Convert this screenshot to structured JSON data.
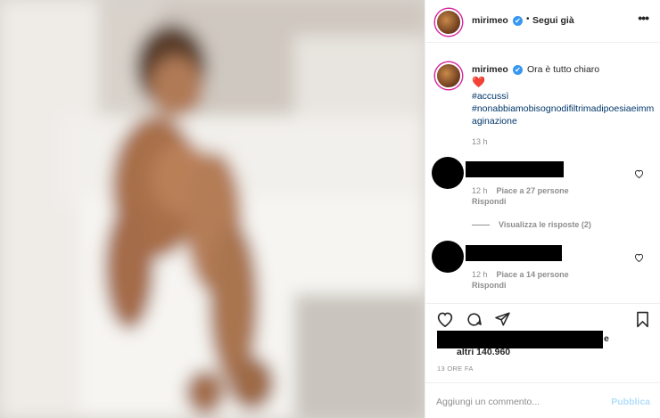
{
  "post": {
    "username": "mirimeo",
    "verified_mark": "✔",
    "dot": "•",
    "follow_label": "Segui già",
    "more_label": "•••",
    "image_description": "blurred-photo-person-sitting-on-bed"
  },
  "caption": {
    "username": "mirimeo",
    "text": "Ora è tutto chiaro",
    "emoji": "❤️",
    "hashtag1": "#accussì",
    "hashtag2": "#nonabbiamobisognodifiltrimadipoesiaeimmaginazione",
    "time": "13 h"
  },
  "comments": [
    {
      "time": "12 h",
      "likes": "Piace a 27 persone",
      "reply": "Rispondi"
    },
    {
      "time": "12 h",
      "likes": "Piace a 14 persone",
      "reply": "Rispondi"
    }
  ],
  "view_replies": "Visualizza le risposte (2)",
  "likes": {
    "trailing": "e",
    "count_text": "altri 140.960"
  },
  "post_time": "13 ORE FA",
  "add_comment": {
    "placeholder": "Aggiungi un commento...",
    "publish_label": "Pubblica"
  },
  "colors": {
    "link": "#00376b",
    "muted": "#8e8e8e",
    "verified": "#3897f0",
    "publish_disabled": "#b2dffc"
  }
}
